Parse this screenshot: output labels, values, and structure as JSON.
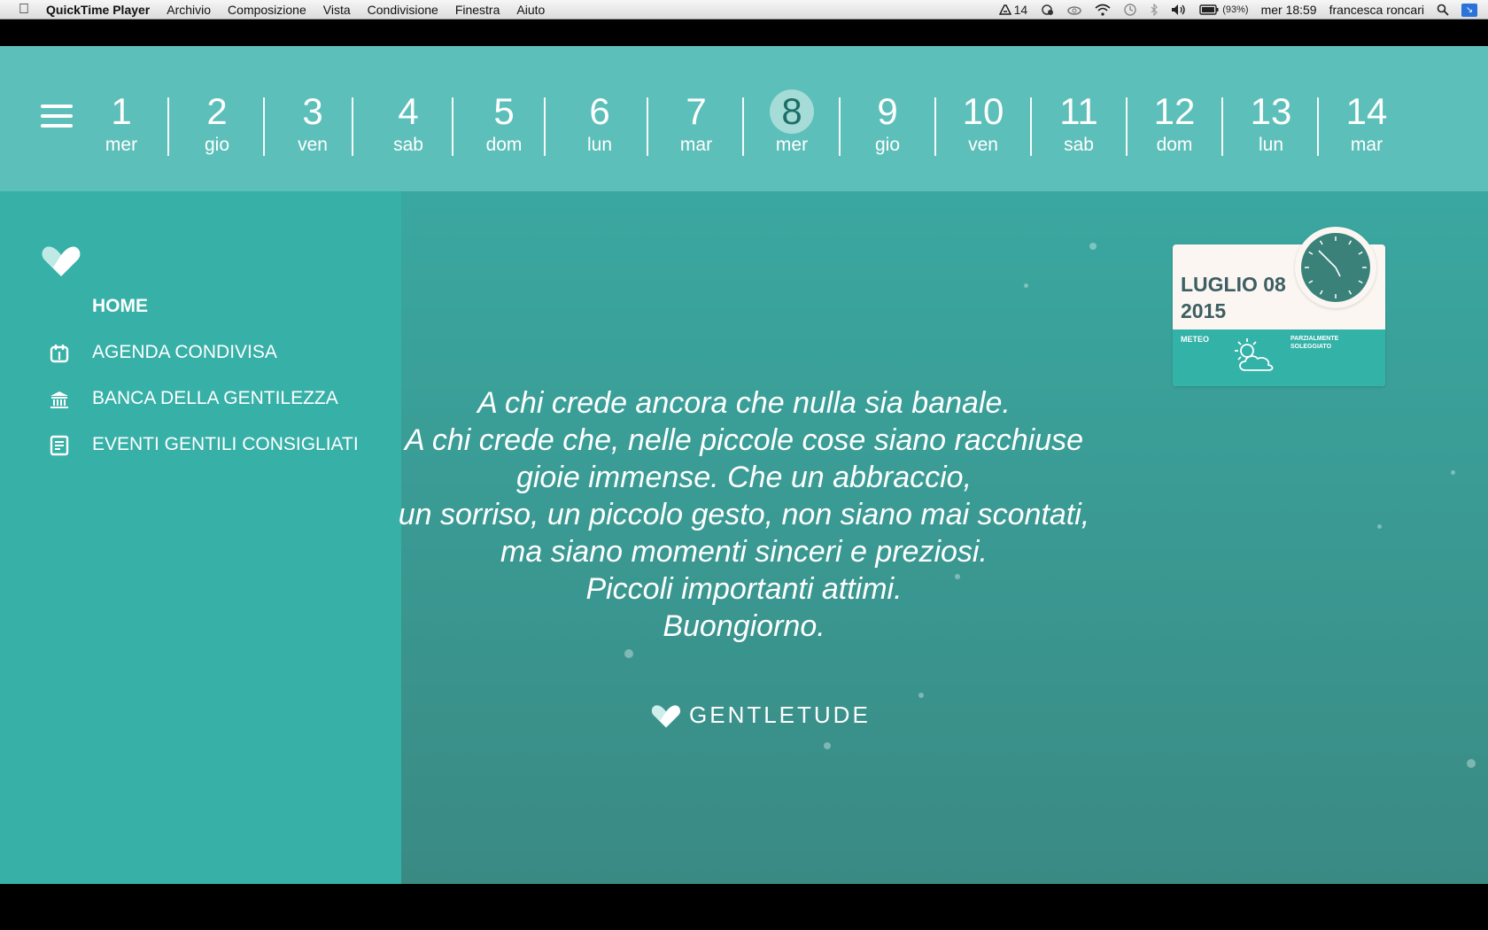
{
  "menubar": {
    "app": "QuickTime Player",
    "items": [
      "Archivio",
      "Composizione",
      "Vista",
      "Condivisione",
      "Finestra",
      "Aiuto"
    ],
    "adobe_count": "14",
    "battery": "(93%)",
    "clock": "mer 18:59",
    "user": "francesca roncari"
  },
  "days": [
    {
      "num": "1",
      "wd": "mer"
    },
    {
      "num": "2",
      "wd": "gio"
    },
    {
      "num": "3",
      "wd": "ven"
    },
    {
      "num": "4",
      "wd": "sab"
    },
    {
      "num": "5",
      "wd": "dom"
    },
    {
      "num": "6",
      "wd": "lun"
    },
    {
      "num": "7",
      "wd": "mar"
    },
    {
      "num": "8",
      "wd": "mer",
      "selected": true
    },
    {
      "num": "9",
      "wd": "gio"
    },
    {
      "num": "10",
      "wd": "ven"
    },
    {
      "num": "11",
      "wd": "sab"
    },
    {
      "num": "12",
      "wd": "dom"
    },
    {
      "num": "13",
      "wd": "lun"
    },
    {
      "num": "14",
      "wd": "mar"
    }
  ],
  "sidebar": {
    "items": [
      {
        "label": "HOME",
        "icon": "none"
      },
      {
        "label": "AGENDA CONDIVISA",
        "icon": "calendar-icon"
      },
      {
        "label": "BANCA DELLA GENTILEZZA",
        "icon": "bank-icon"
      },
      {
        "label": "EVENTI GENTILI CONSIGLIATI",
        "icon": "document-icon"
      }
    ]
  },
  "quote": {
    "lines": [
      "A chi crede ancora che nulla sia banale.",
      "A chi crede che, nelle piccole cose siano racchiuse",
      "gioie immense. Che un abbraccio,",
      "un sorriso, un piccolo gesto, non siano mai scontati,",
      "ma siano momenti sinceri e preziosi.",
      "Piccoli importanti attimi.",
      "Buongiorno."
    ]
  },
  "brand": {
    "name": "GENTLETUDE"
  },
  "widget": {
    "date_line1": "LUGLIO 08",
    "date_line2": "2015",
    "meteo_label": "METEO",
    "condition_line1": "PARZIALMENTE",
    "condition_line2": "SOLEGGIATO"
  },
  "colors": {
    "daybar": "#5dbfb9",
    "sidebar": "#37b0a7",
    "accent_dark": "#3d5e62"
  }
}
